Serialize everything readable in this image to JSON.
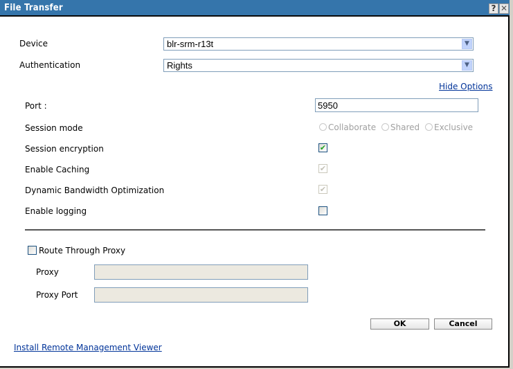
{
  "dialog": {
    "title": "File Transfer",
    "help_icon": "?",
    "close_icon": "✕"
  },
  "form": {
    "device": {
      "label": "Device",
      "value": "blr-srm-r13t"
    },
    "authentication": {
      "label": "Authentication",
      "value": "Rights"
    },
    "hide_options_link": "Hide Options",
    "port": {
      "label": "Port :",
      "value": "5950"
    },
    "session_mode": {
      "label": "Session mode",
      "options": [
        "Collaborate",
        "Shared",
        "Exclusive"
      ],
      "selected": null,
      "disabled": true
    },
    "session_encryption": {
      "label": "Session encryption",
      "checked": true,
      "disabled": false
    },
    "enable_caching": {
      "label": "Enable Caching",
      "checked": true,
      "disabled": true
    },
    "dynamic_bandwidth": {
      "label": "Dynamic Bandwidth Optimization",
      "checked": true,
      "disabled": true
    },
    "enable_logging": {
      "label": "Enable logging",
      "checked": false,
      "disabled": false
    },
    "route_through_proxy": {
      "label": "Route Through Proxy",
      "checked": false
    },
    "proxy": {
      "label": "Proxy",
      "value": ""
    },
    "proxy_port": {
      "label": "Proxy Port",
      "value": ""
    }
  },
  "buttons": {
    "ok": "OK",
    "cancel": "Cancel"
  },
  "footer_link": "Install Remote Management Viewer",
  "icons": {
    "check": "✔",
    "dropdown": "⌄"
  }
}
